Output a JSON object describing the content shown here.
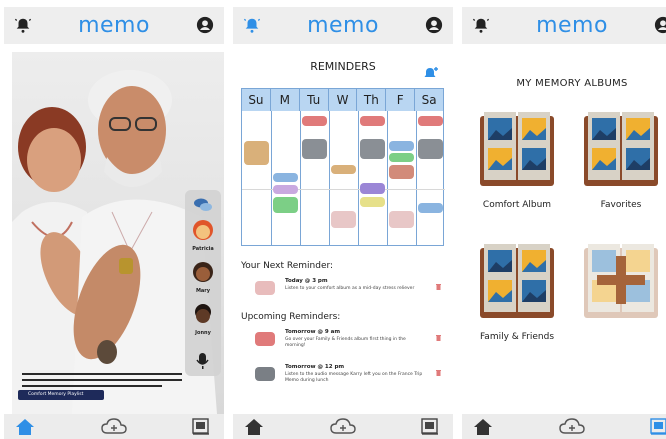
{
  "app": {
    "logo": "memo"
  },
  "screen1": {
    "contacts": [
      {
        "name": "Patricia"
      },
      {
        "name": "Mary"
      },
      {
        "name": "Jonny"
      }
    ],
    "playlist_label": "Comfort Memory Playlist"
  },
  "screen2": {
    "title": "REMINDERS",
    "days": [
      "Su",
      "M",
      "Tu",
      "W",
      "Th",
      "F",
      "Sa"
    ],
    "next_label": "Your Next Reminder:",
    "next": {
      "time": "Today @ 3 pm",
      "desc": "Listen to your comfort album as a mid-day stress reliever",
      "color": "#e8bcbc"
    },
    "upcoming_label": "Upcoming Reminders:",
    "upcoming": [
      {
        "time": "Tomorrow @ 9 am",
        "desc": "Go over your Family & Friends album first thing in the morning!",
        "color": "#e07a7a"
      },
      {
        "time": "Tomorrow @ 12 pm",
        "desc": "Listen to the audio message Karry left you on the France Trip Memo during lunch",
        "color": "#7a7f85"
      }
    ],
    "colors": {
      "red": "#e07a7a",
      "gray": "#8a8f95",
      "tan": "#d9b07a",
      "blue": "#8ab4e0",
      "purple": "#9b86d6",
      "green": "#7ccf86",
      "pink": "#e8c7c7",
      "yellow": "#e6e08a",
      "lilac": "#c9a9e0"
    }
  },
  "screen3": {
    "title": "MY MEMORY ALBUMS",
    "albums": [
      {
        "label": "Comfort Album"
      },
      {
        "label": "Favorites"
      },
      {
        "label": "Family & Friends"
      }
    ]
  },
  "palette": {
    "accent": "#2f8fe6",
    "topbar": "#eeeeee"
  }
}
